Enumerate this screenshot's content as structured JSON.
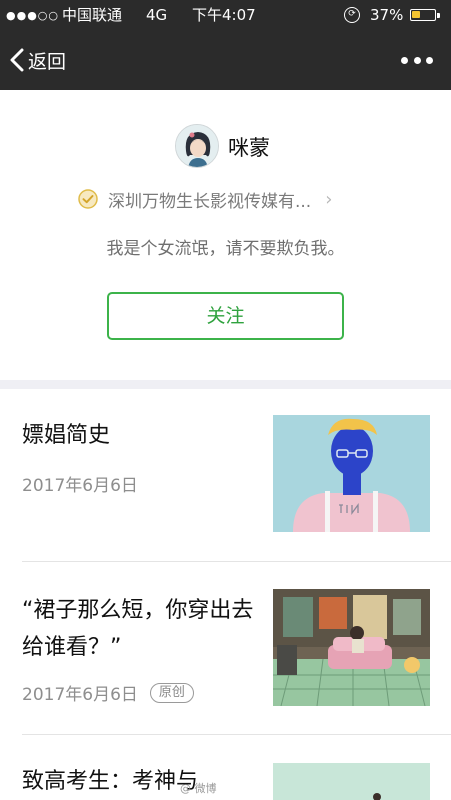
{
  "status_bar": {
    "signal": "●●●○○",
    "carrier": "中国联通",
    "network": "4G",
    "time": "下午4:07",
    "battery_percent": "37%",
    "battery_level": 0.37,
    "battery_color": "#f5c531"
  },
  "nav": {
    "back_label": "返回",
    "back_icon": "chevron-left-icon",
    "more_icon": "more-dots-icon"
  },
  "profile": {
    "name": "咪蒙",
    "verified_org": "深圳万物生长影视传媒有...",
    "verify_icon": "verified-check-icon",
    "chevron": "›",
    "signature": "我是个女流氓，请不要欺负我。",
    "follow_label": "关注",
    "accent_color": "#3cb34a"
  },
  "articles": [
    {
      "title": "嫖娼简史",
      "date": "2017年6月6日",
      "badge": ""
    },
    {
      "title": "“裙子那么短，你穿出去给谁看？”",
      "date": "2017年6月6日",
      "badge": "原创"
    },
    {
      "title": "致高考生：考神与",
      "date": "",
      "badge": ""
    }
  ]
}
